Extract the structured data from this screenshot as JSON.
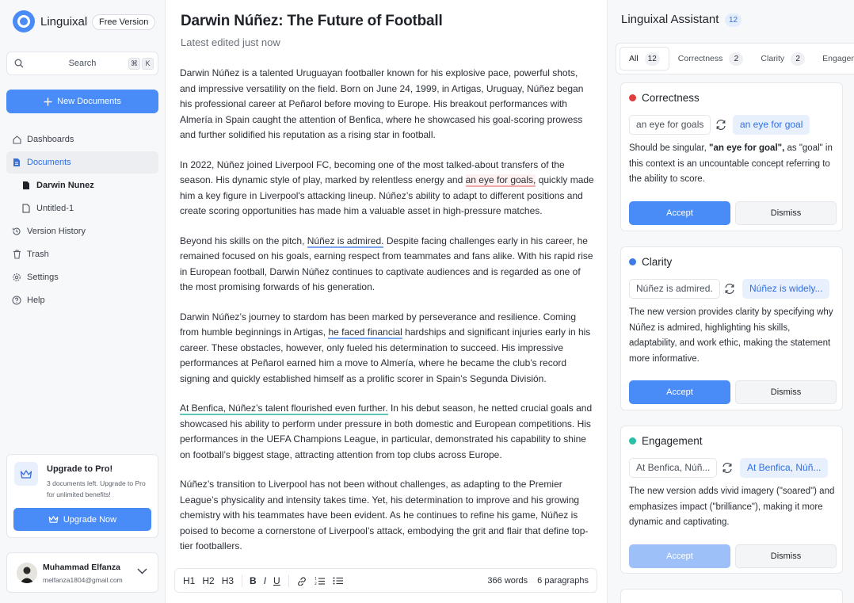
{
  "sidebar": {
    "brand": "Linguixal",
    "plan": "Free Version",
    "search": {
      "label": "Search",
      "kbd": [
        "⌘",
        "K"
      ]
    },
    "new_doc": "New Documents",
    "nav": [
      {
        "label": "Dashboards",
        "icon": "home-icon"
      },
      {
        "label": "Documents",
        "icon": "document-icon",
        "active": true
      },
      {
        "label": "Darwin Nunez",
        "icon": "file-filled-icon"
      },
      {
        "label": "Untitled-1",
        "icon": "file-outline-icon"
      },
      {
        "label": "Version History",
        "icon": "history-icon"
      },
      {
        "label": "Trash",
        "icon": "trash-icon"
      },
      {
        "label": "Settings",
        "icon": "gear-icon"
      },
      {
        "label": "Help",
        "icon": "help-icon"
      }
    ],
    "upgrade": {
      "title": "Upgrade to Pro!",
      "desc": "3 documents left. Upgrade to Pro for unlimited benefits!",
      "button": "Upgrade Now"
    },
    "user": {
      "name": "Muhammad Elfanza",
      "email": "melfanza1804@gmail.com"
    }
  },
  "editor": {
    "title": "Darwin Núñez: The Future of Football",
    "subtitle": "Latest edited just now",
    "p1": "Darwin Núñez is a talented Uruguayan footballer known for his explosive pace, powerful shots, and impressive versatility on the field. Born on June 24, 1999, in Artigas, Uruguay, Núñez began his professional career at Peñarol before moving to Europe. His breakout performances with Almería in Spain caught the attention of Benfica, where he showcased his goal-scoring prowess and further solidified his reputation as a rising star in football.",
    "p2_a": "In 2022, Núñez joined Liverpool FC, becoming one of the most talked-about transfers of the season. His dynamic style of play, marked by relentless energy and ",
    "p2_hl": "an eye for goals,",
    "p2_b": " quickly made him a key figure in Liverpool's attacking lineup. Núñez’s ability to adapt to different positions and create scoring opportunities has made him a valuable asset in high-pressure matches.",
    "p3_a": "Beyond his skills on the pitch, ",
    "p3_hl": "Núñez is admired.",
    "p3_b": " Despite facing challenges early in his career, he remained focused on his goals, earning respect from teammates and fans alike. With his rapid rise in European football, Darwin Núñez continues to captivate audiences and is regarded as one of the most promising forwards of his generation.",
    "p4_a": "Darwin Núñez’s journey to stardom has been marked by perseverance and resilience. Coming from humble beginnings in Artigas, ",
    "p4_hl": "he faced financial",
    "p4_b": " hardships and significant injuries early in his career. These obstacles, however, only fueled his determination to succeed. His impressive performances at Peñarol earned him a move to Almería, where he became the club’s record signing and quickly established himself as a prolific scorer in Spain’s Segunda División.",
    "p5_hl": "At Benfica, Núñez’s talent flourished even further.",
    "p5_b": " In his debut season, he netted crucial goals and showcased his ability to perform under pressure in both domestic and European competitions. His performances in the UEFA Champions League, in particular, demonstrated his capability to shine on football’s biggest stage, attracting attention from top clubs across Europe.",
    "p6": "Núñez’s transition to Liverpool has not been without challenges, as adapting to the Premier League’s physicality and intensity takes time. Yet, his determination to improve and his growing chemistry with his teammates have been evident. As he continues to refine his game, Núñez is poised to become a cornerstone of Liverpool’s attack, embodying the grit and flair that define top-tier footballers.",
    "toolbar": {
      "h1": "H1",
      "h2": "H2",
      "h3": "H3",
      "bold": "B",
      "italic": "I",
      "underline": "U",
      "words": "366 words",
      "paragraphs": "6 paragraphs"
    }
  },
  "assistant": {
    "title": "Linguixal Assistant",
    "count": "12",
    "tabs": [
      {
        "label": "All",
        "count": "12"
      },
      {
        "label": "Correctness",
        "count": "2"
      },
      {
        "label": "Clarity",
        "count": "2"
      },
      {
        "label": "Engagement",
        "count": ""
      }
    ],
    "cards": [
      {
        "category": "Correctness",
        "color": "#e03e3e",
        "old": "an eye for goals",
        "new": "an eye for goal",
        "desc_a": "Should be singular, ",
        "desc_bold": "\"an eye for goal\",",
        "desc_b": " as \"goal\" in this context is an uncountable concept referring to the ability to score.",
        "accept": "Accept",
        "dismiss": "Dismiss"
      },
      {
        "category": "Clarity",
        "color": "#3f7be8",
        "old": "Núñez is admired.",
        "new": "Núñez is widely...",
        "desc": "The new version provides clarity by specifying why Núñez is admired, highlighting his skills, adaptability, and work ethic, making the statement more informative.",
        "accept": "Accept",
        "dismiss": "Dismiss"
      },
      {
        "category": "Engagement",
        "color": "#2bbfa8",
        "old": "At Benfica, Núñ...",
        "new": "At Benfica, Núñ...",
        "desc": "The new version adds vivid imagery (\"soared\") and emphasizes impact (\"brilliance\"), making it more dynamic and captivating.",
        "accept": "Accept",
        "dismiss": "Dismiss"
      }
    ]
  }
}
